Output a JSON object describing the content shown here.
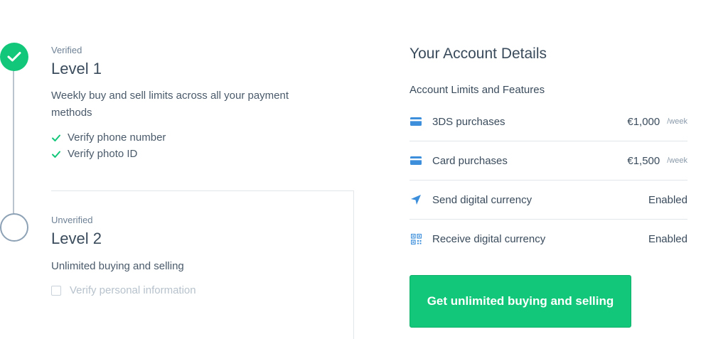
{
  "levels": [
    {
      "status": "Verified",
      "title": "Level 1",
      "description": "Weekly buy and sell limits across all your payment methods",
      "requirements": [
        "Verify phone number",
        "Verify photo ID"
      ]
    },
    {
      "status": "Unverified",
      "title": "Level 2",
      "description": "Unlimited buying and selling",
      "requirements": [
        "Verify personal information"
      ]
    }
  ],
  "account": {
    "title": "Your Account Details",
    "subtitle": "Account Limits and Features",
    "rows": [
      {
        "icon": "card-icon",
        "label": "3DS purchases",
        "value": "€1,000",
        "unit": "/week"
      },
      {
        "icon": "card-icon",
        "label": "Card purchases",
        "value": "€1,500",
        "unit": "/week"
      },
      {
        "icon": "send-icon",
        "label": "Send digital currency",
        "value": "Enabled",
        "unit": ""
      },
      {
        "icon": "qr-code-icon",
        "label": "Receive digital currency",
        "value": "Enabled",
        "unit": ""
      }
    ],
    "cta_label": "Get unlimited buying and selling"
  },
  "colors": {
    "accent": "#12c77a",
    "icon_blue": "#3d8fdc",
    "text": "#3a4b5c",
    "muted": "#6f8296"
  }
}
